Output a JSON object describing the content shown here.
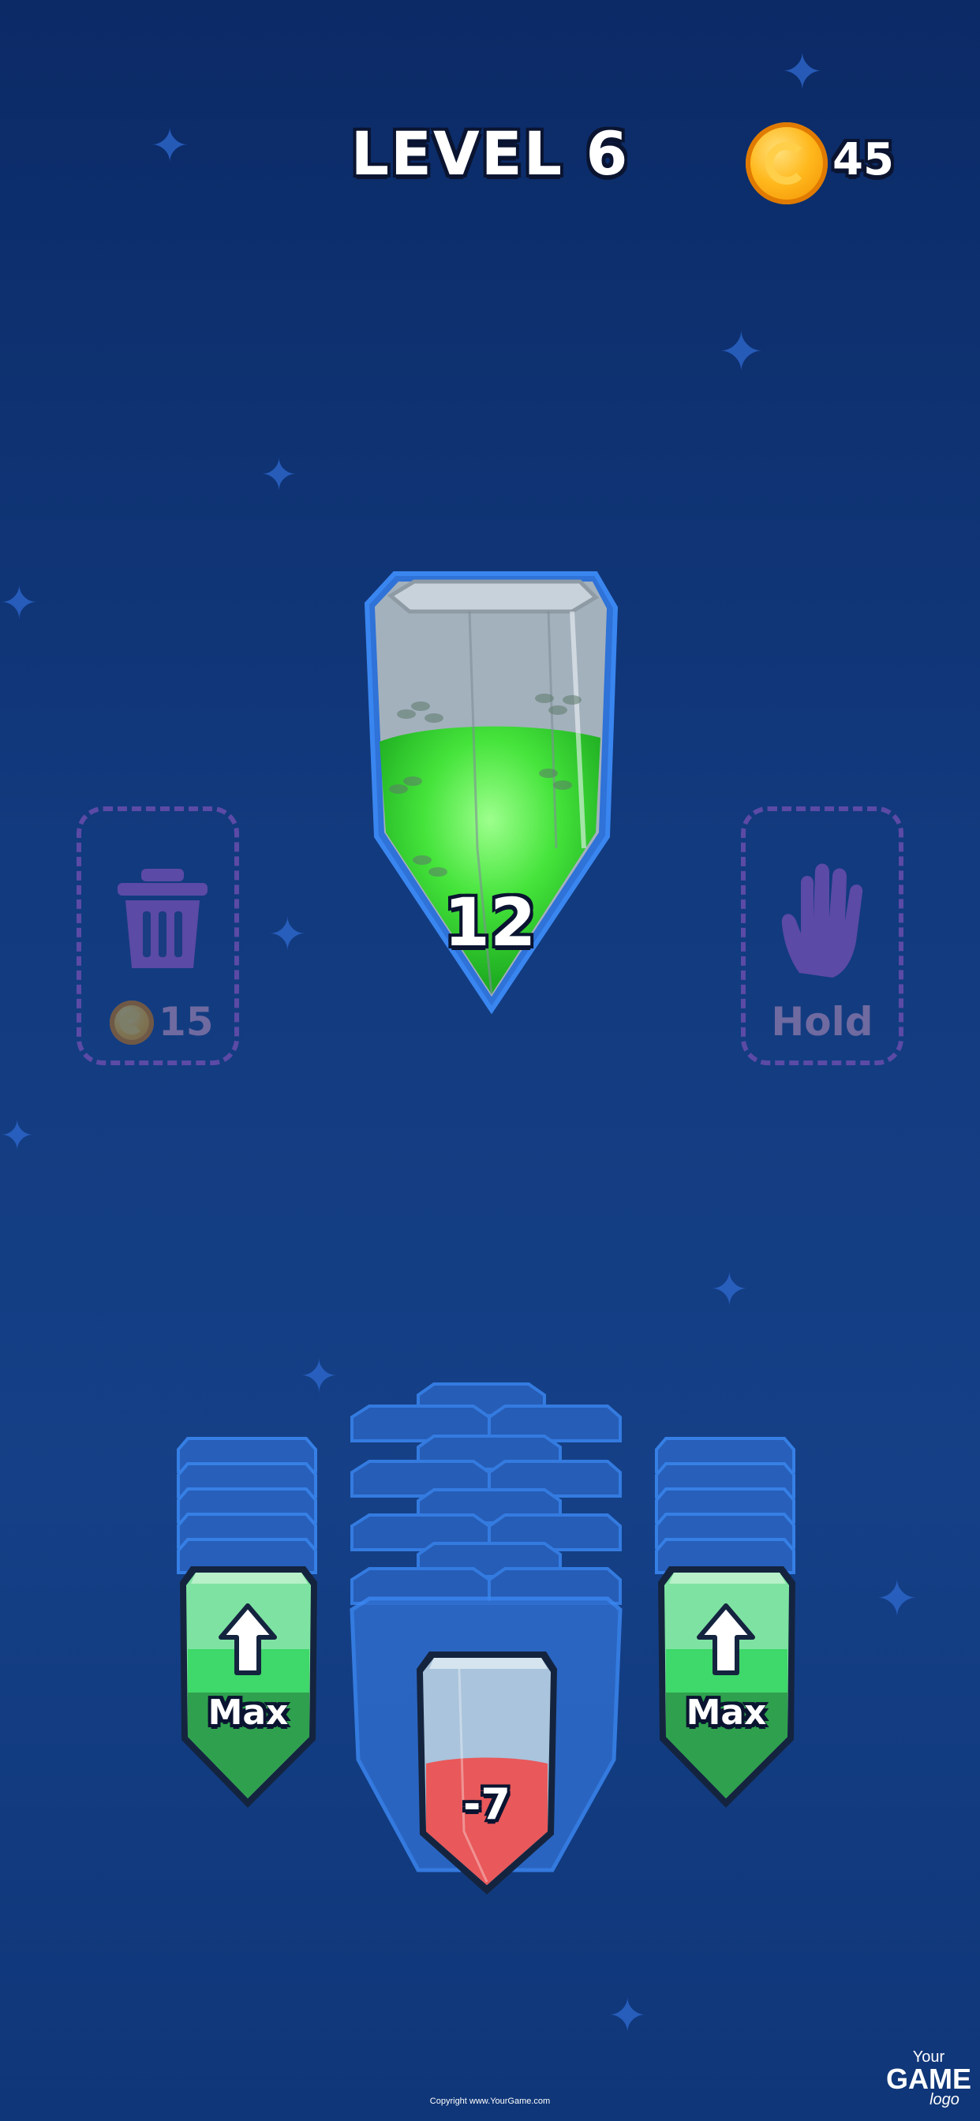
{
  "hud": {
    "level_title": "LEVEL 6",
    "coins": "45"
  },
  "main_crystal": {
    "value": "12",
    "fill_color": "#3fe23a"
  },
  "trash_slot": {
    "icon": "trash-icon",
    "cost": "15"
  },
  "hold_slot": {
    "icon": "hand-icon",
    "label": "Hold"
  },
  "tray": {
    "left_crystal": {
      "label": "Max",
      "icon": "arrow-up-icon"
    },
    "center_crystal": {
      "value": "-7",
      "fill_color": "#ef5b5b"
    },
    "right_crystal": {
      "label": "Max",
      "icon": "arrow-up-icon"
    }
  },
  "footer": {
    "copyright": "Copyright www.YourGame.com",
    "logo_top": "Your",
    "logo_main": "GAME",
    "logo_bottom": "logo"
  }
}
